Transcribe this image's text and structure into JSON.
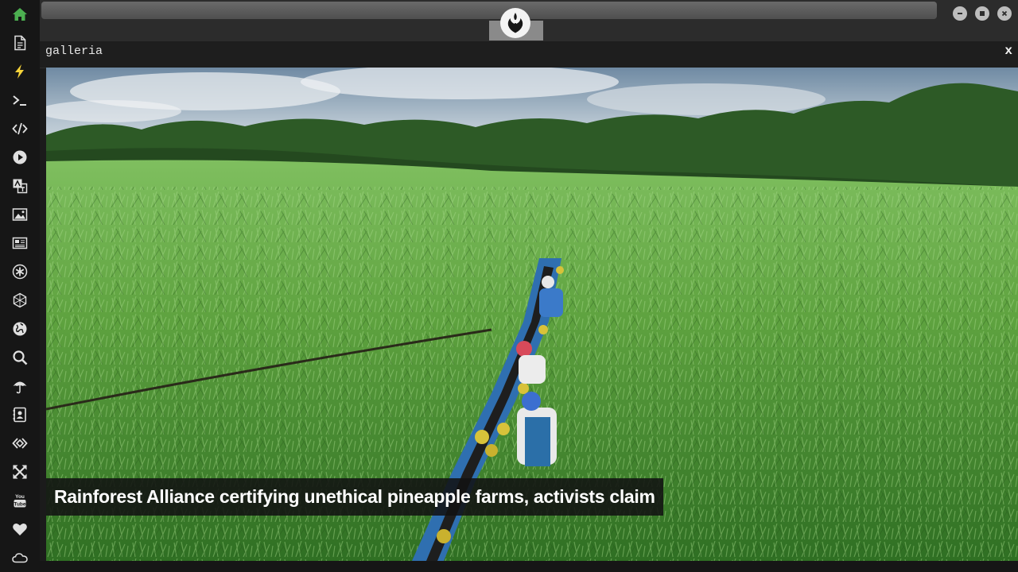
{
  "app": {
    "panel_title": "galleria",
    "close_label": "x"
  },
  "sidebar": {
    "items": [
      {
        "name": "home",
        "icon": "home-icon",
        "color": "#4caf50"
      },
      {
        "name": "documents",
        "icon": "document-icon"
      },
      {
        "name": "flash",
        "icon": "lightning-icon",
        "color": "#f5d33a"
      },
      {
        "name": "terminal",
        "icon": "terminal-icon"
      },
      {
        "name": "code",
        "icon": "code-icon"
      },
      {
        "name": "play",
        "icon": "play-icon"
      },
      {
        "name": "translate",
        "icon": "translate-icon"
      },
      {
        "name": "gallery",
        "icon": "image-icon"
      },
      {
        "name": "news",
        "icon": "newspaper-icon"
      },
      {
        "name": "asterisk",
        "icon": "asterisk-icon"
      },
      {
        "name": "hexagon",
        "icon": "hexagon-icon"
      },
      {
        "name": "globe",
        "icon": "globe-icon"
      },
      {
        "name": "search",
        "icon": "search-icon"
      },
      {
        "name": "weather",
        "icon": "umbrella-icon"
      },
      {
        "name": "contacts",
        "icon": "contact-card-icon"
      },
      {
        "name": "dev",
        "icon": "code-diamond-icon"
      },
      {
        "name": "expand",
        "icon": "expand-arrows-icon"
      },
      {
        "name": "youtube",
        "icon": "youtube-icon"
      },
      {
        "name": "favorites",
        "icon": "heart-icon"
      },
      {
        "name": "cloud",
        "icon": "cloud-icon"
      }
    ]
  },
  "window_controls": [
    {
      "name": "minimize",
      "icon": "minimize-icon"
    },
    {
      "name": "maximize",
      "icon": "maximize-icon"
    },
    {
      "name": "close",
      "icon": "close-icon"
    }
  ],
  "gallery": {
    "caption": "Rainforest Alliance certifying unethical pineapple farms, activists claim"
  },
  "colors": {
    "sidebar_bg": "#161616",
    "home_green": "#4caf50",
    "flash_yellow": "#f5d33a",
    "caption_bg": "#121212"
  }
}
